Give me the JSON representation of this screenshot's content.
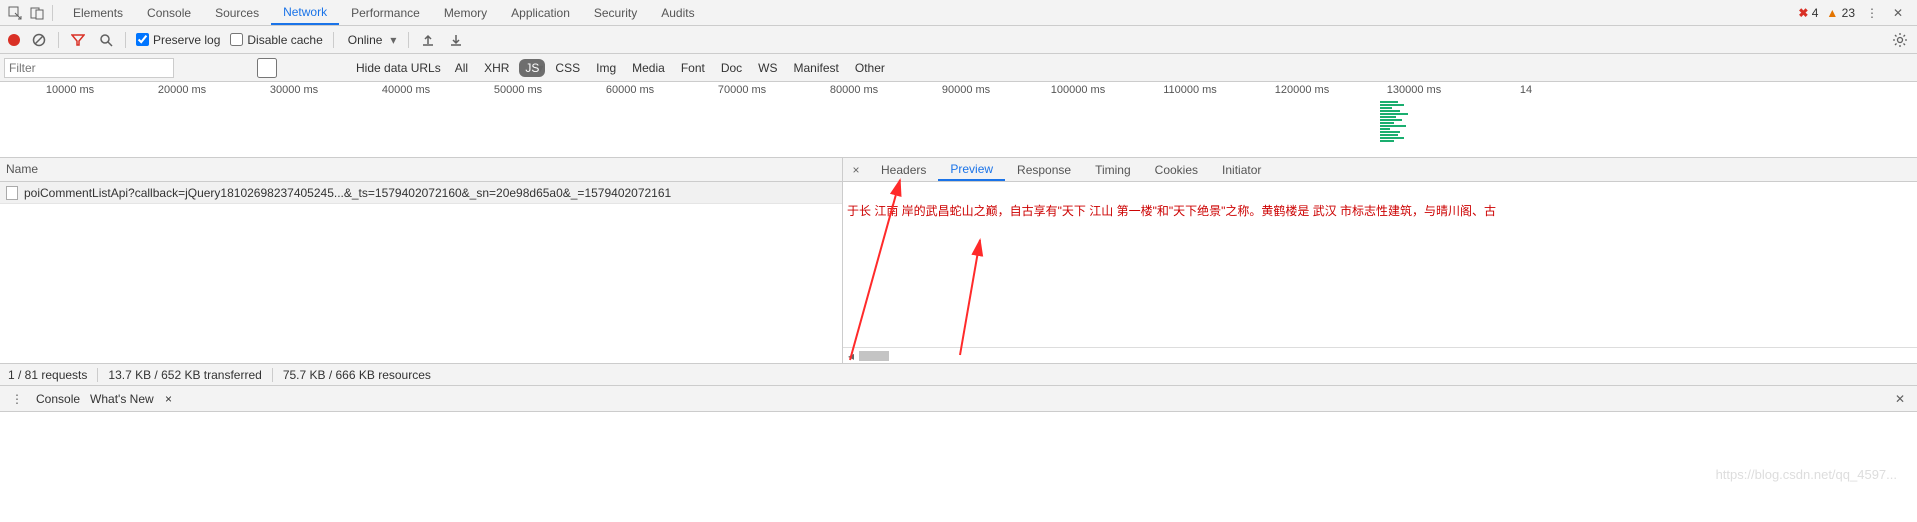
{
  "top_tabs": [
    "Elements",
    "Console",
    "Sources",
    "Network",
    "Performance",
    "Memory",
    "Application",
    "Security",
    "Audits"
  ],
  "top_active": "Network",
  "errors": {
    "err_count": "4",
    "warn_count": "23"
  },
  "toolbar": {
    "preserve": "Preserve log",
    "disable": "Disable cache",
    "online": "Online"
  },
  "filter": {
    "placeholder": "Filter",
    "hide": "Hide data URLs",
    "types": [
      "All",
      "XHR",
      "JS",
      "CSS",
      "Img",
      "Media",
      "Font",
      "Doc",
      "WS",
      "Manifest",
      "Other"
    ],
    "sel": "JS"
  },
  "timeline": [
    "10000 ms",
    "20000 ms",
    "30000 ms",
    "40000 ms",
    "50000 ms",
    "60000 ms",
    "70000 ms",
    "80000 ms",
    "90000 ms",
    "100000 ms",
    "110000 ms",
    "120000 ms",
    "130000 ms",
    "14"
  ],
  "requests": {
    "header": "Name",
    "row": "poiCommentListApi?callback=jQuery18102698237405245...&_ts=1579402072160&_sn=20e98d65a0&_=1579402072161"
  },
  "detail_tabs": [
    "Headers",
    "Preview",
    "Response",
    "Timing",
    "Cookies",
    "Initiator"
  ],
  "detail_active": "Preview",
  "preview_text": "于长  江南  岸的武昌蛇山之巅，自古享有\"天下  江山  第一楼\"和\"天下绝景\"之称。黄鹤楼是  武汉  市标志性建筑，与晴川阁、古",
  "status": {
    "req": "1 / 81 requests",
    "xfer": "13.7 KB / 652 KB transferred",
    "res": "75.7 KB / 666 KB resources"
  },
  "drawer": {
    "t1": "Console",
    "t2": "What's New"
  },
  "watermark": "https://blog.csdn.net/qq_4597..."
}
